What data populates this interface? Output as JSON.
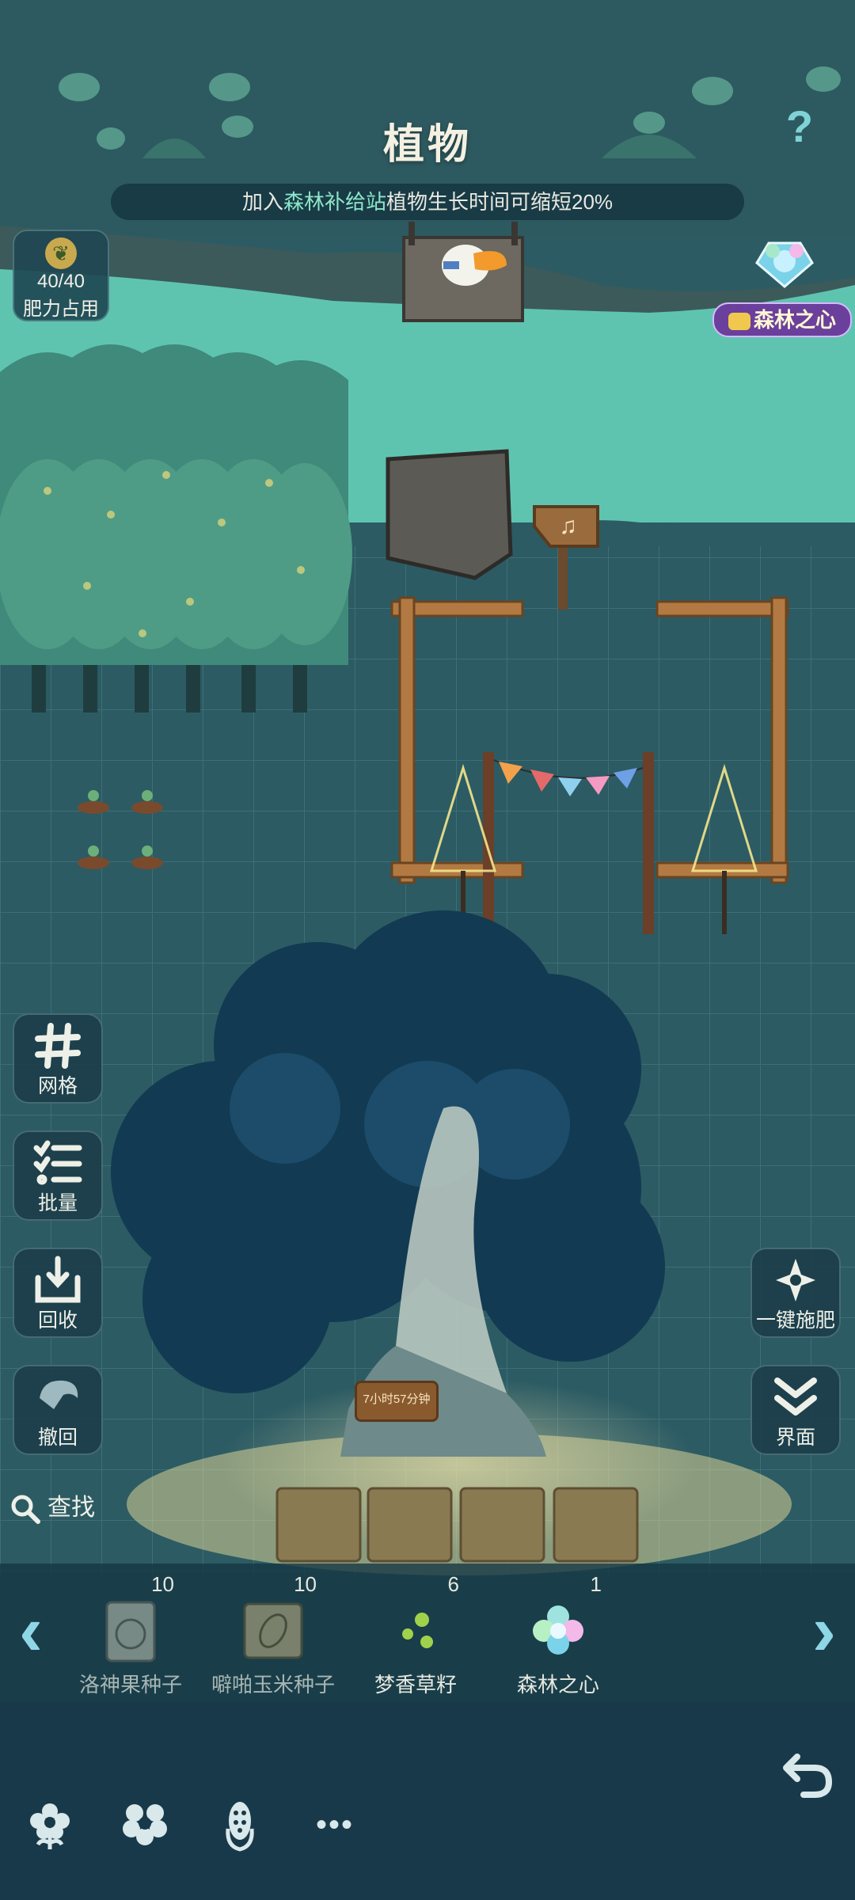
{
  "header": {
    "title": "植物",
    "help_symbol": "?",
    "banner": {
      "prefix": "加入",
      "highlight": "森林补给站",
      "suffix": "植物生长时间可缩短20%"
    }
  },
  "fertilizer": {
    "count": "40/40",
    "label": "肥力占用"
  },
  "forest_heart_badge": {
    "label": "森林之心"
  },
  "signpost_symbol": "♫",
  "big_tree": {
    "timer": "7小时57分钟"
  },
  "left_buttons": [
    {
      "label": "网格",
      "icon": "grid-icon"
    },
    {
      "label": "批量",
      "icon": "checklist-icon"
    },
    {
      "label": "回收",
      "icon": "recycle-icon"
    },
    {
      "label": "撤回",
      "icon": "undo-icon"
    }
  ],
  "right_buttons": [
    {
      "label": "一键施肥",
      "icon": "fertilize-icon"
    },
    {
      "label": "界面",
      "icon": "double-chevron-down-icon"
    }
  ],
  "search": {
    "label": "查找"
  },
  "tray": {
    "left_arrow": "‹",
    "right_arrow": "›",
    "items": [
      {
        "name": "洛神果种子",
        "count": "10",
        "icon": "seed-packet-icon"
      },
      {
        "name": "噼啪玉米种子",
        "count": "10",
        "icon": "corn-seed-packet-icon"
      },
      {
        "name": "梦香草籽",
        "count": "6",
        "icon": "green-seeds-icon"
      },
      {
        "name": "森林之心",
        "count": "1",
        "icon": "forest-heart-gem-icon"
      }
    ]
  },
  "bottom_nav": {
    "items": [
      {
        "icon": "flower-icon"
      },
      {
        "icon": "blossom-icon"
      },
      {
        "icon": "corn-icon"
      },
      {
        "icon": "more-icon",
        "label": "•••"
      }
    ]
  },
  "colors": {
    "water": "#5ec4b0",
    "ground": "#2c5b63",
    "banner_highlight": "#8ee6c9",
    "forest_heart_tag": "#6b3f9c"
  }
}
